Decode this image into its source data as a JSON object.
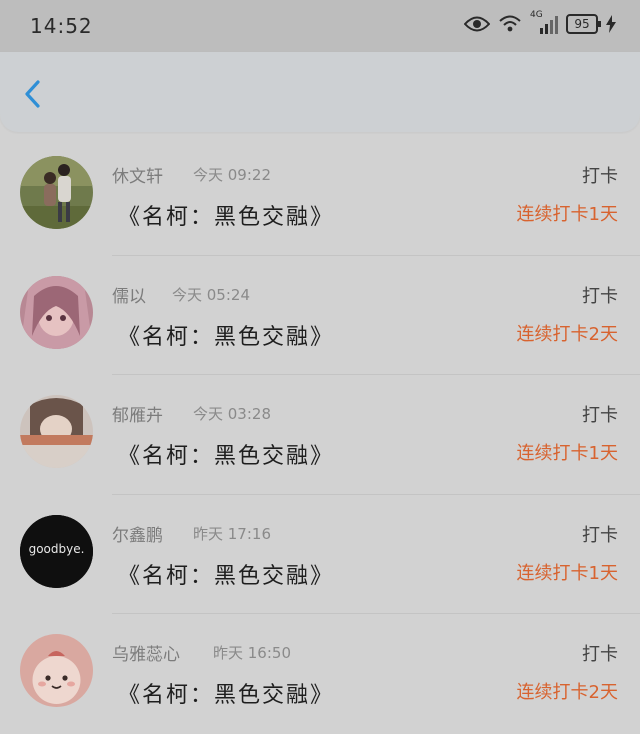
{
  "status_bar": {
    "time": "14:52",
    "network": "4G",
    "battery": "95",
    "icons": [
      "eye-icon",
      "wifi-icon",
      "signal-icon",
      "battery-icon",
      "charging-icon"
    ]
  },
  "nav": {
    "back_icon": "chevron-left-icon",
    "accent": "#2f8fd6"
  },
  "feed": [
    {
      "name": "休文轩",
      "time": "今天 09:22",
      "title": "《名柯：黑色交融》",
      "action": "打卡",
      "streak": "连续打卡1天"
    },
    {
      "name": "儒以",
      "time": "今天 05:24",
      "title": "《名柯：黑色交融》",
      "action": "打卡",
      "streak": "连续打卡2天"
    },
    {
      "name": "郁雁卉",
      "time": "今天 03:28",
      "title": "《名柯：黑色交融》",
      "action": "打卡",
      "streak": "连续打卡1天"
    },
    {
      "name": "尔鑫鹏",
      "time": "昨天 17:16",
      "title": "《名柯：黑色交融》",
      "action": "打卡",
      "streak": "连续打卡1天"
    },
    {
      "name": "乌雅蕊心",
      "time": "昨天 16:50",
      "title": "《名柯：黑色交融》",
      "action": "打卡",
      "streak": "连续打卡2天"
    }
  ],
  "avatar_art": {
    "goodbye_text": "goodbye."
  },
  "colors": {
    "streak": "#d8632f",
    "background": "#d2d2d2"
  }
}
